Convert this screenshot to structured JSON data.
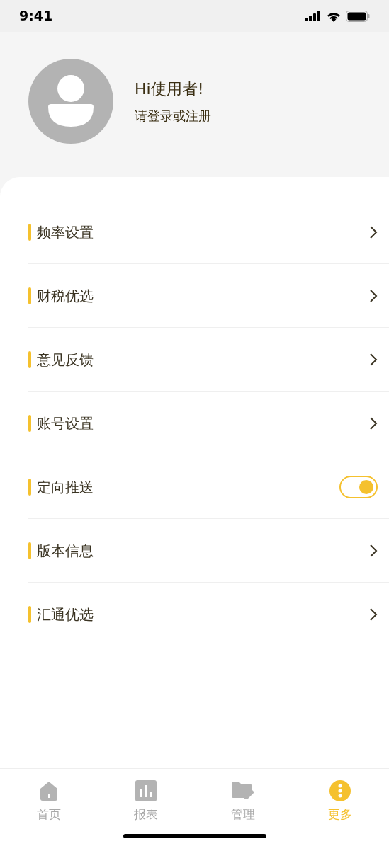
{
  "status_bar": {
    "time": "9:41"
  },
  "profile": {
    "greeting": "Hi使用者!",
    "prompt": "请登录或注册"
  },
  "menu": [
    {
      "kind": "link",
      "label": "频率设置"
    },
    {
      "kind": "link",
      "label": "财税优选"
    },
    {
      "kind": "link",
      "label": "意见反馈"
    },
    {
      "kind": "link",
      "label": "账号设置"
    },
    {
      "kind": "toggle",
      "label": "定向推送",
      "on": true
    },
    {
      "kind": "link",
      "label": "版本信息"
    },
    {
      "kind": "link",
      "label": "汇通优选"
    }
  ],
  "tab_bar": [
    {
      "kind": "home",
      "label": "首页",
      "selected": false
    },
    {
      "kind": "chart",
      "label": "报表",
      "selected": false
    },
    {
      "kind": "folder",
      "label": "管理",
      "selected": false
    },
    {
      "kind": "more",
      "label": "更多",
      "selected": true
    }
  ]
}
